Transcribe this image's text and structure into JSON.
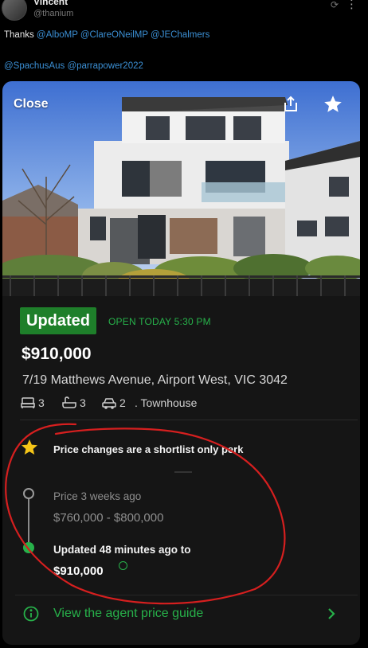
{
  "post": {
    "author_name": "Vincent",
    "author_handle": "@thanium",
    "text_prefix": "Thanks ",
    "mentions_line1": [
      "@AlboMP",
      "@ClareONeilMP",
      "@JEChalmers"
    ],
    "mentions_line2": [
      "@SpachusAus",
      "@parrapower2022"
    ]
  },
  "listing": {
    "close_label": "Close",
    "badge": "Updated",
    "inspection": "OPEN TODAY 5:30 PM",
    "price": "$910,000",
    "address": "7/19 Matthews Avenue, Airport West, VIC 3042",
    "bedrooms": "3",
    "bathrooms": "3",
    "parking": "2",
    "property_type": ". Townhouse"
  },
  "price_history": {
    "perk_text": "Price changes are a shortlist only perk",
    "previous_label": "Price 3 weeks ago",
    "previous_range": "$760,000 - $800,000",
    "updated_label": "Updated 48 minutes ago to",
    "updated_price": "$910,000"
  },
  "agent_guide": {
    "link_label": "View the agent price guide"
  },
  "colors": {
    "accent_green": "#27b14a",
    "badge_green": "#1e7f2a",
    "star_yellow": "#f5c518",
    "annotation_red": "#d61f1f"
  },
  "icons": [
    "share-icon",
    "star-icon",
    "bed-icon",
    "bath-icon",
    "car-icon",
    "info-icon",
    "chevron-right-icon"
  ]
}
